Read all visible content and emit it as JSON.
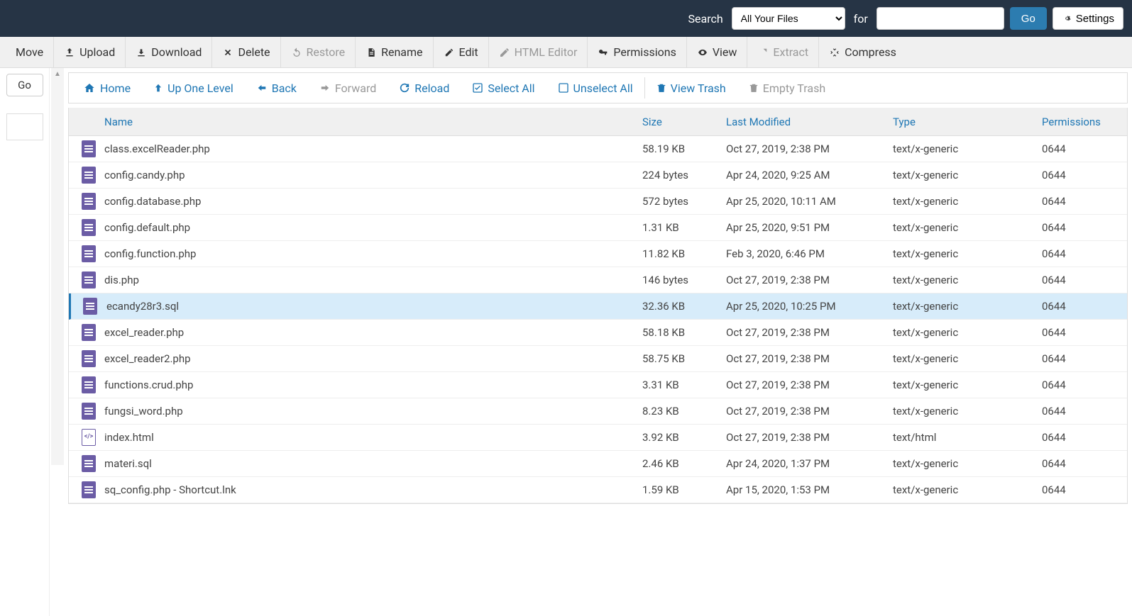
{
  "top": {
    "searchLabel": "Search",
    "selectValue": "All Your Files",
    "forLabel": "for",
    "goLabel": "Go",
    "settingsLabel": "Settings"
  },
  "actions": {
    "move": "Move",
    "upload": "Upload",
    "download": "Download",
    "delete": "Delete",
    "restore": "Restore",
    "rename": "Rename",
    "edit": "Edit",
    "htmlEditor": "HTML Editor",
    "permissions": "Permissions",
    "view": "View",
    "extract": "Extract",
    "compress": "Compress"
  },
  "leftGo": "Go",
  "nav": {
    "home": "Home",
    "upOne": "Up One Level",
    "back": "Back",
    "forward": "Forward",
    "reload": "Reload",
    "selectAll": "Select All",
    "unselectAll": "Unselect All",
    "viewTrash": "View Trash",
    "emptyTrash": "Empty Trash"
  },
  "columns": {
    "name": "Name",
    "size": "Size",
    "modified": "Last Modified",
    "type": "Type",
    "permissions": "Permissions"
  },
  "files": [
    {
      "name": "class.excelReader.php",
      "size": "58.19 KB",
      "modified": "Oct 27, 2019, 2:38 PM",
      "type": "text/x-generic",
      "perm": "0644",
      "icon": "doc",
      "selected": false
    },
    {
      "name": "config.candy.php",
      "size": "224 bytes",
      "modified": "Apr 24, 2020, 9:25 AM",
      "type": "text/x-generic",
      "perm": "0644",
      "icon": "doc",
      "selected": false
    },
    {
      "name": "config.database.php",
      "size": "572 bytes",
      "modified": "Apr 25, 2020, 10:11 AM",
      "type": "text/x-generic",
      "perm": "0644",
      "icon": "doc",
      "selected": false
    },
    {
      "name": "config.default.php",
      "size": "1.31 KB",
      "modified": "Apr 25, 2020, 9:51 PM",
      "type": "text/x-generic",
      "perm": "0644",
      "icon": "doc",
      "selected": false
    },
    {
      "name": "config.function.php",
      "size": "11.82 KB",
      "modified": "Feb 3, 2020, 6:46 PM",
      "type": "text/x-generic",
      "perm": "0644",
      "icon": "doc",
      "selected": false
    },
    {
      "name": "dis.php",
      "size": "146 bytes",
      "modified": "Oct 27, 2019, 2:38 PM",
      "type": "text/x-generic",
      "perm": "0644",
      "icon": "doc",
      "selected": false
    },
    {
      "name": "ecandy28r3.sql",
      "size": "32.36 KB",
      "modified": "Apr 25, 2020, 10:25 PM",
      "type": "text/x-generic",
      "perm": "0644",
      "icon": "doc",
      "selected": true
    },
    {
      "name": "excel_reader.php",
      "size": "58.18 KB",
      "modified": "Oct 27, 2019, 2:38 PM",
      "type": "text/x-generic",
      "perm": "0644",
      "icon": "doc",
      "selected": false
    },
    {
      "name": "excel_reader2.php",
      "size": "58.75 KB",
      "modified": "Oct 27, 2019, 2:38 PM",
      "type": "text/x-generic",
      "perm": "0644",
      "icon": "doc",
      "selected": false
    },
    {
      "name": "functions.crud.php",
      "size": "3.31 KB",
      "modified": "Oct 27, 2019, 2:38 PM",
      "type": "text/x-generic",
      "perm": "0644",
      "icon": "doc",
      "selected": false
    },
    {
      "name": "fungsi_word.php",
      "size": "8.23 KB",
      "modified": "Oct 27, 2019, 2:38 PM",
      "type": "text/x-generic",
      "perm": "0644",
      "icon": "doc",
      "selected": false
    },
    {
      "name": "index.html",
      "size": "3.92 KB",
      "modified": "Oct 27, 2019, 2:38 PM",
      "type": "text/html",
      "perm": "0644",
      "icon": "html",
      "selected": false
    },
    {
      "name": "materi.sql",
      "size": "2.46 KB",
      "modified": "Apr 24, 2020, 1:37 PM",
      "type": "text/x-generic",
      "perm": "0644",
      "icon": "doc",
      "selected": false
    },
    {
      "name": "sq_config.php - Shortcut.lnk",
      "size": "1.59 KB",
      "modified": "Apr 15, 2020, 1:53 PM",
      "type": "text/x-generic",
      "perm": "0644",
      "icon": "doc",
      "selected": false
    }
  ]
}
